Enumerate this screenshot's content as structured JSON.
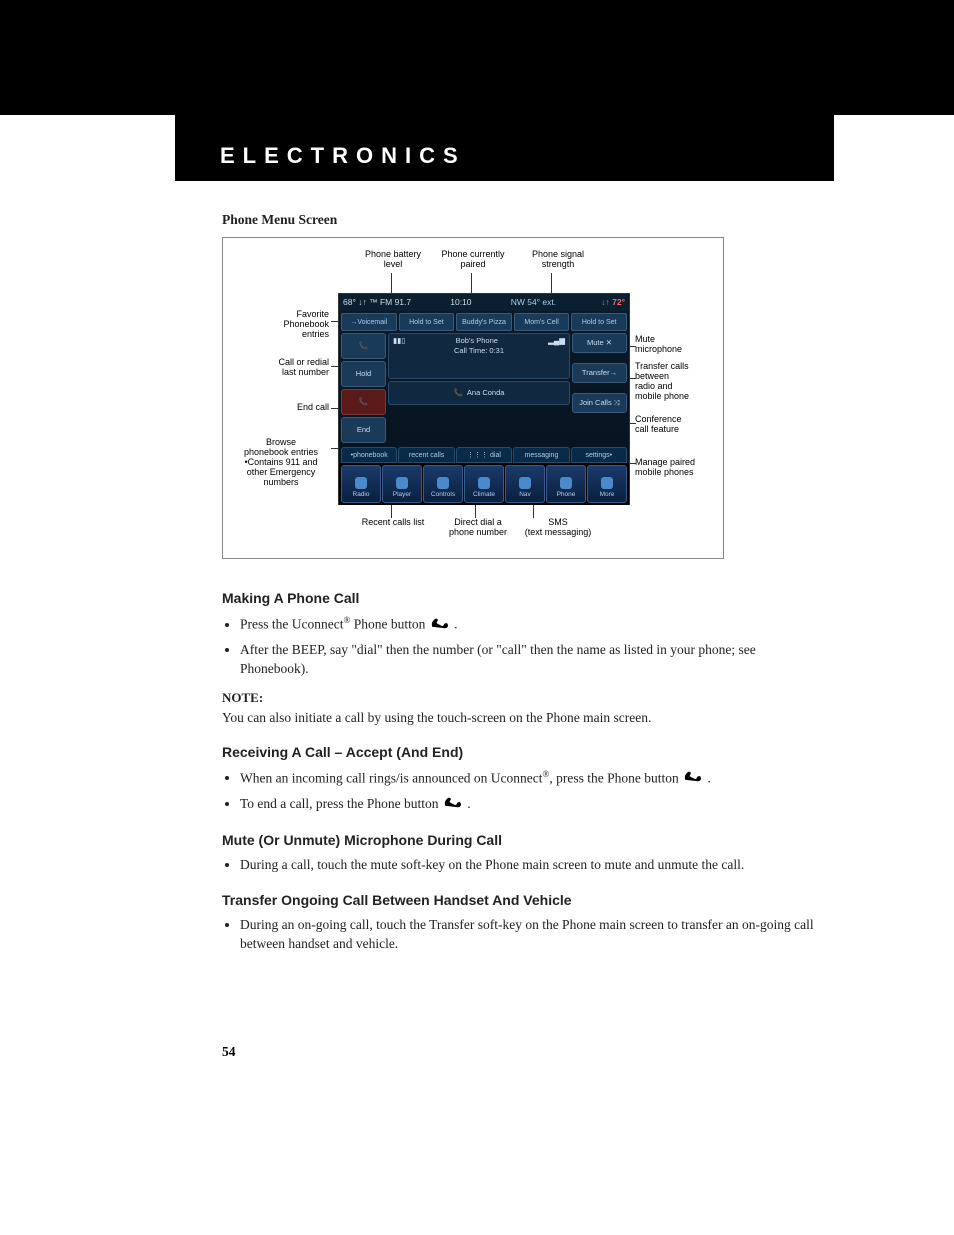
{
  "header": "ELECTRONICS",
  "figure_title": "Phone Menu Screen",
  "callouts": {
    "top1": "Phone battery\nlevel",
    "top2": "Phone currently\npaired",
    "top3": "Phone signal\nstrength",
    "left1": "Favorite\nPhonebook\nentries",
    "left2": "Call or redial\nlast number",
    "left3": "End call",
    "left4": "Browse\nphonebook entries\n•Contains 911 and\nother Emergency\nnumbers",
    "right1": "Mute\nmicrophone",
    "right2": "Transfer calls\nbetween\nradio and\nmobile phone",
    "right3": "Conference\ncall feature",
    "right4": "Manage paired\nmobile phones",
    "bot1": "Recent calls list",
    "bot2": "Direct dial a\nphone number",
    "bot3": "SMS\n(text messaging)"
  },
  "screen": {
    "status_left": "68° ↓↑ ™ FM 91.7",
    "status_time": "10:10",
    "status_mid": "NW 54° ext.",
    "status_right": "↓↑ 72°",
    "favs": [
      "→Voicemail",
      "Hold to Set",
      "Buddy's Pizza",
      "Mom's Cell",
      "Hold to Set"
    ],
    "left_btns": [
      "Hold",
      "End"
    ],
    "right_btns": [
      "Mute ✕",
      "Transfer→",
      "Join Calls ⤨"
    ],
    "center1": "Bob's Phone",
    "center2": "Call Time: 0:31",
    "center3": "Ana Conda",
    "tabs": [
      "•phonebook",
      "recent calls",
      "⋮⋮⋮ dial",
      "messaging",
      "settings•"
    ],
    "nav": [
      "Radio",
      "Player",
      "Controls",
      "Climate",
      "Nav",
      "Phone",
      "More"
    ]
  },
  "sections": {
    "making_title": "Making A Phone Call",
    "making_b1a": "Press the Uconnect",
    "making_b1b": " Phone button ",
    "making_b1_end": " .",
    "making_b2": "After the BEEP, say \"dial\" then the number (or \"call\" then the name as listed in your phone; see Phonebook).",
    "note_label": "NOTE:",
    "note_text": "You can also initiate a call by using the touch-screen on the Phone main screen.",
    "receiving_title": "Receiving A Call – Accept (And End)",
    "receiving_b1a": "When an incoming call rings/is announced on Uconnect",
    "receiving_b1b": ", press the Phone button ",
    "receiving_b1_end": " .",
    "receiving_b2a": "To end a call, press the Phone button ",
    "receiving_b2_end": " .",
    "mute_title": "Mute (Or Unmute) Microphone During Call",
    "mute_b1": "During a call, touch the mute soft-key on the Phone main screen to mute and unmute the call.",
    "transfer_title": "Transfer Ongoing Call Between Handset And Vehicle",
    "transfer_b1": "During an on-going call, touch the Transfer soft-key on the Phone main screen to transfer an on-going call between handset and vehicle."
  },
  "page_number": "54",
  "reg_mark": "®"
}
